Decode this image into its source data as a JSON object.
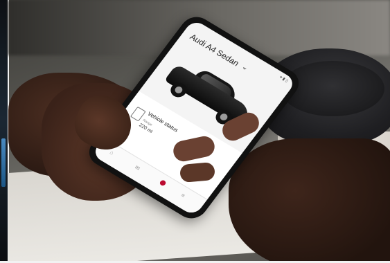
{
  "app": {
    "title": "Audi A4 Sedan",
    "title_chevron": "⌄",
    "status_bar_text": "▾ ▮ ▯",
    "accent_color": "#bb0a30"
  },
  "vehicle_status": {
    "label": "Vehicle status",
    "range_label": "Range",
    "range_value": "220 mi",
    "icon": "phone-car-icon",
    "refresh_icon": "refresh-icon"
  },
  "bottom_nav": {
    "items": [
      {
        "icon": "home-icon",
        "glyph": "⌂"
      },
      {
        "icon": "key-icon",
        "glyph": "✉"
      },
      {
        "icon": "location-icon",
        "glyph": "●"
      },
      {
        "icon": "menu-icon",
        "glyph": "≡"
      }
    ]
  }
}
